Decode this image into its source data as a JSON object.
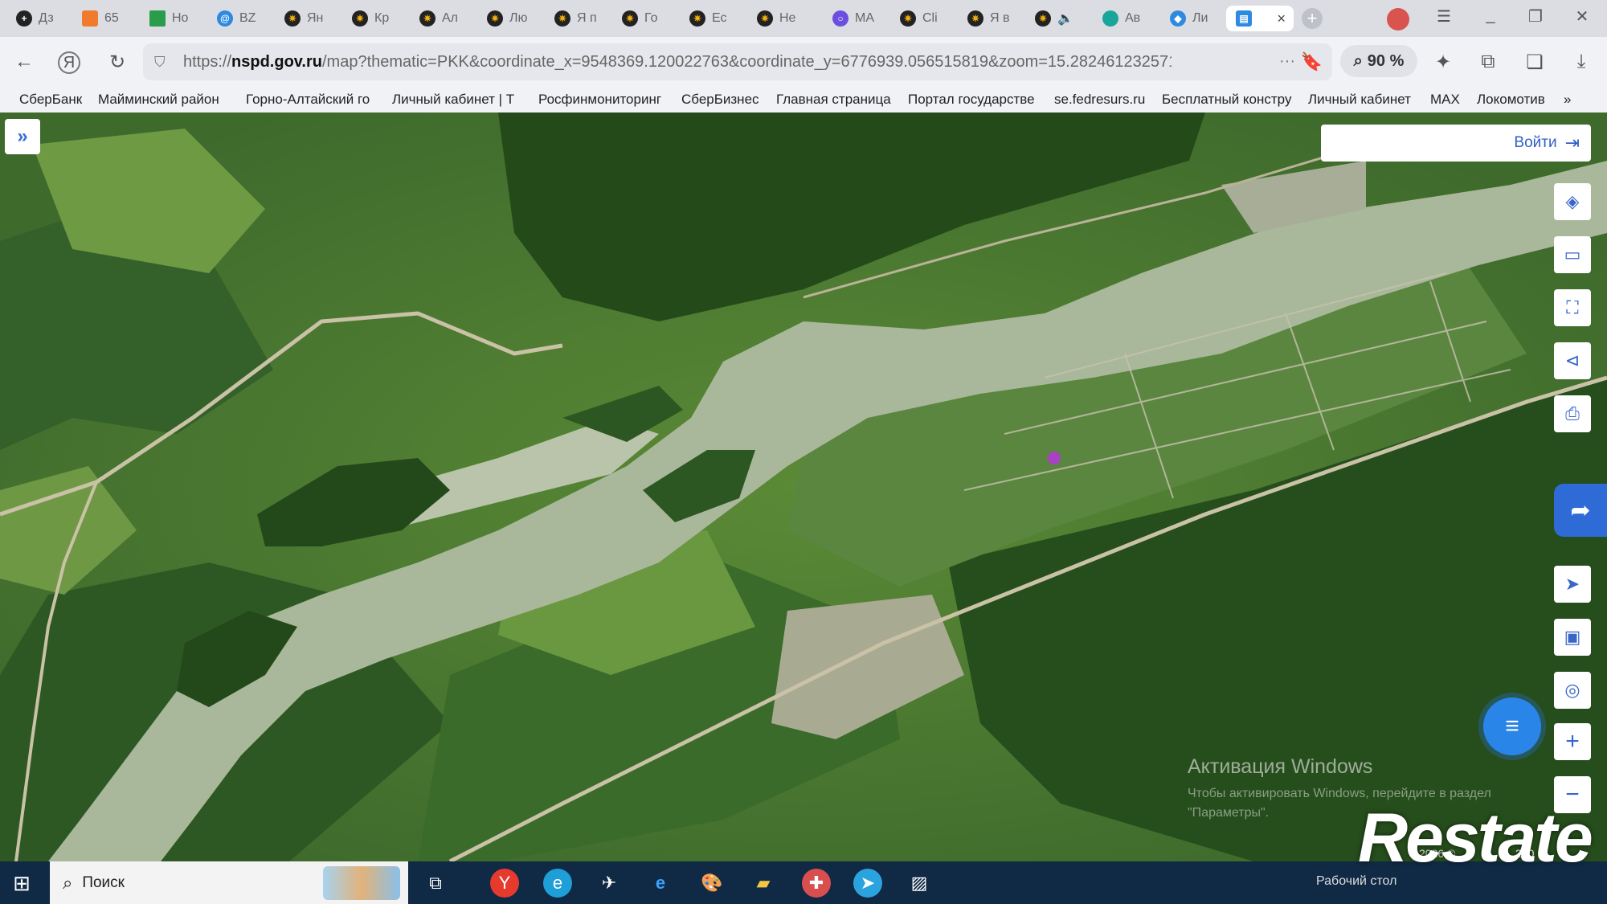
{
  "tabs": [
    {
      "label": "Дз",
      "color": "#222222"
    },
    {
      "label": "65",
      "color": "#f07b2c"
    },
    {
      "label": "Но",
      "color": "#2b9c4a"
    },
    {
      "label": "BZ",
      "color": "#2d8ae0"
    },
    {
      "label": "Ян",
      "color": "#f2b10a"
    },
    {
      "label": "Кр",
      "color": "#f2b10a"
    },
    {
      "label": "Ал",
      "color": "#f2b10a"
    },
    {
      "label": "Лю",
      "color": "#f2b10a"
    },
    {
      "label": "Я п",
      "color": "#f2b10a"
    },
    {
      "label": "Го",
      "color": "#f2b10a"
    },
    {
      "label": "Ес",
      "color": "#f2b10a"
    },
    {
      "label": "Не",
      "color": "#f2b10a"
    },
    {
      "label": "МА",
      "color": "#6c4ee0"
    },
    {
      "label": "Cli",
      "color": "#f2b10a"
    },
    {
      "label": "Я в",
      "color": "#f2b10a"
    },
    {
      "label": "",
      "color": "#f2b10a"
    },
    {
      "label": "Ав",
      "color": "#1aa59b"
    },
    {
      "label": "Ли",
      "color": "#2d8ae0"
    }
  ],
  "active_tab_close": "×",
  "url": {
    "prefix": "https://",
    "domain": "nspd.gov.ru",
    "path": "/map?thematic=PKK&coordinate_x=9548369.120022763&coordinate_y=6776939.056515819&zoom=15.28246123257110...",
    "zoom": "90 %"
  },
  "bookmarks": [
    "СберБанк",
    "Майминский район",
    "Горно-Алтайский го",
    "Личный кабинет | Т",
    "Росфинмониторинг",
    "СберБизнес",
    "Главная страница",
    "Портал государстве",
    "se.fedresurs.ru",
    "Бесплатный констру",
    "Личный кабинет",
    "MAX",
    "Локомотив"
  ],
  "bookmarks_more": "»",
  "map": {
    "login_label": "Войти",
    "watermark_title": "Активация Windows",
    "watermark_sub": "Чтобы активировать Windows, перейдите в раздел \"Параметры\".",
    "scale_label": "200",
    "copyright": "2026 ©"
  },
  "taskbar": {
    "search_label": "Поиск",
    "tray_text": "Рабочий стол"
  },
  "logo_text": "Restate",
  "colors": {
    "forest": "#2f5a22",
    "meadow": "#5e8c3a",
    "river": "#a9b89a",
    "road": "#c9c2a6",
    "accent": "#2f6bd6"
  }
}
